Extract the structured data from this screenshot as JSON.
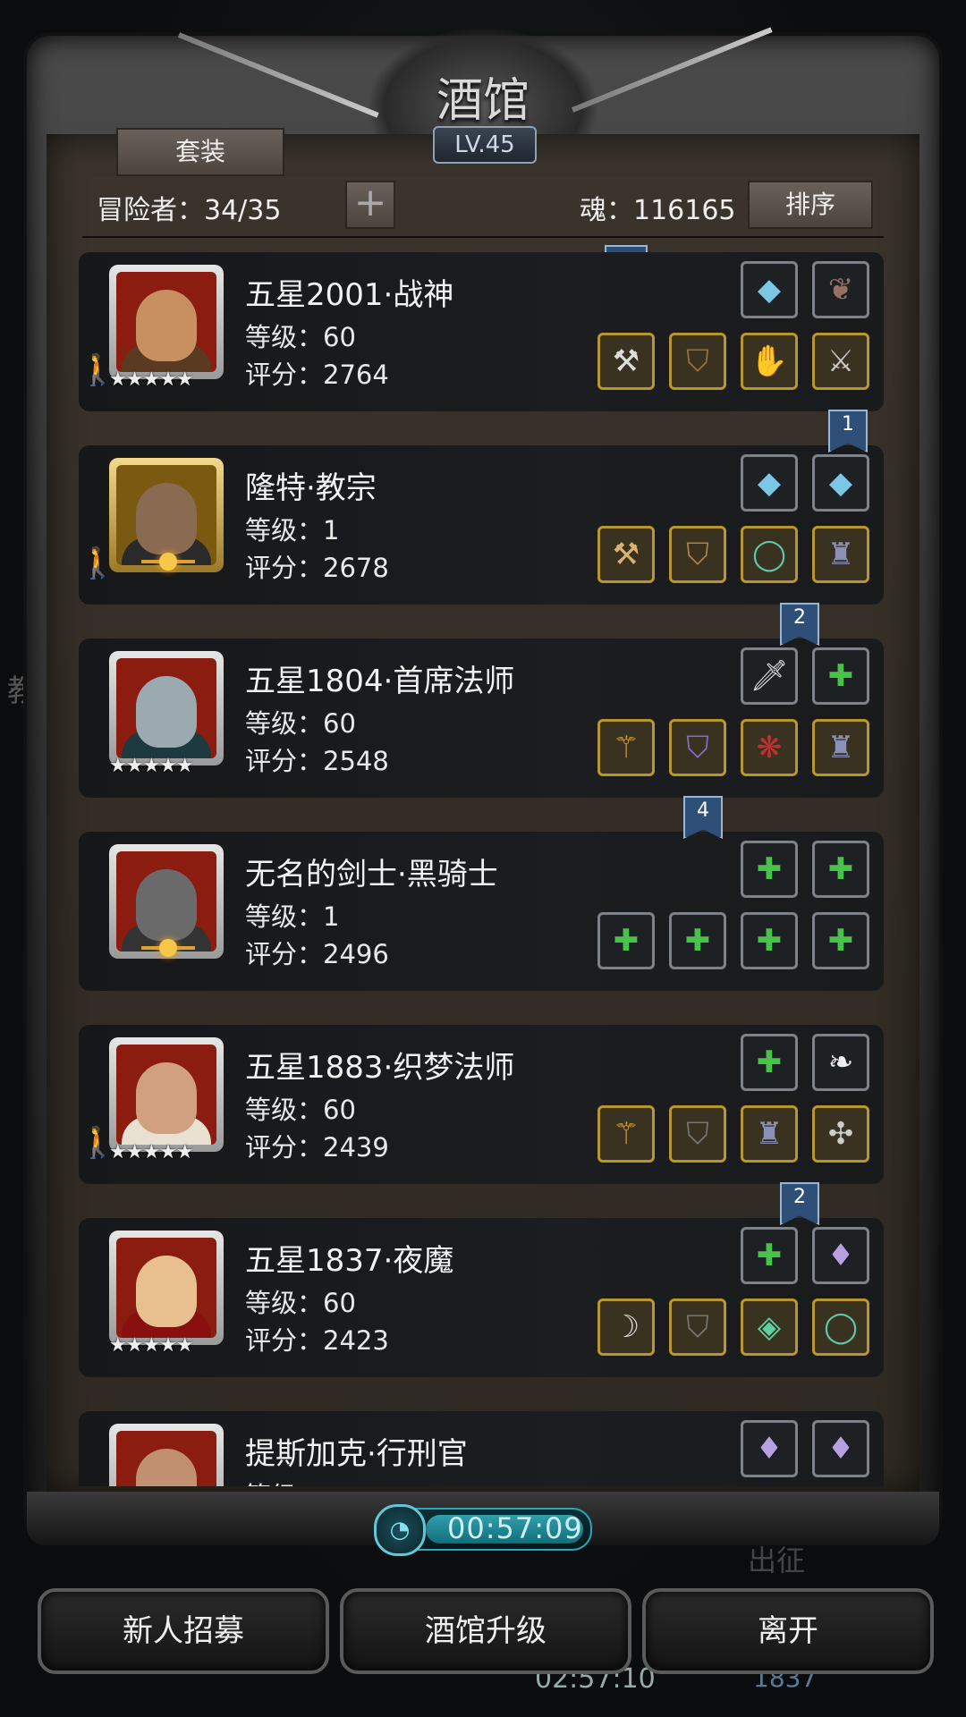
{
  "title": "酒馆",
  "level_badge": "LV.45",
  "suit_button": "套装",
  "adventurers": "冒险者：34/35",
  "plus_button": "+",
  "soul": "魂：116165",
  "sort_button": "排序",
  "background": {
    "side_text": "教",
    "bottom_timer": "02:57:10",
    "bottom_num": "1837",
    "chuzheng": "出征"
  },
  "heroes": [
    {
      "name": "五星2001·战神",
      "level": "等级：60",
      "score": "评分：2764",
      "frame": "red",
      "stars": "★★★★★",
      "badge": "star-walker",
      "top_slots": [
        {
          "icon": "blue-gem-icon",
          "border": "grey"
        },
        {
          "icon": "dark-feather-icon",
          "border": "grey"
        }
      ],
      "bottom_slots": [
        {
          "icon": "axe-icon",
          "border": "gold"
        },
        {
          "icon": "leather-armor-icon",
          "border": "gold"
        },
        {
          "icon": "gauntlet-icon",
          "border": "gold"
        },
        {
          "icon": "claw-icon",
          "border": "gold"
        }
      ]
    },
    {
      "name": "隆特·教宗",
      "level": "等级：1",
      "score": "评分：2678",
      "frame": "gold",
      "stars": "",
      "badge": "moon-walker",
      "flag": "1",
      "top_slots": [
        {
          "icon": "blue-gem-icon",
          "border": "grey"
        },
        {
          "icon": "blue-gem-icon",
          "border": "grey"
        }
      ],
      "bottom_slots": [
        {
          "icon": "hammer-icon",
          "border": "gold"
        },
        {
          "icon": "chest-armor-icon",
          "border": "gold"
        },
        {
          "icon": "ring-icon",
          "border": "gold"
        },
        {
          "icon": "boots-icon",
          "border": "gold"
        }
      ]
    },
    {
      "name": "五星1804·首席法师",
      "level": "等级：60",
      "score": "评分：2548",
      "frame": "red",
      "stars": "★★★★★",
      "badge": "stars",
      "flag": "2",
      "top_slots": [
        {
          "icon": "dagger-icon",
          "border": "grey"
        },
        {
          "icon": "empty-slot-icon",
          "border": "grey"
        }
      ],
      "bottom_slots": [
        {
          "icon": "staff-icon",
          "border": "gold"
        },
        {
          "icon": "purple-armor-icon",
          "border": "gold"
        },
        {
          "icon": "amulet-icon",
          "border": "gold"
        },
        {
          "icon": "boots-icon",
          "border": "gold"
        }
      ]
    },
    {
      "name": "无名的剑士·黑骑士",
      "level": "等级：1",
      "score": "评分：2496",
      "frame": "red",
      "stars": "",
      "badge": "moon",
      "flag": "4",
      "top_slots": [
        {
          "icon": "empty-slot-icon",
          "border": "grey"
        },
        {
          "icon": "empty-slot-icon",
          "border": "grey"
        }
      ],
      "bottom_slots": [
        {
          "icon": "empty-weapon-icon",
          "border": "grey"
        },
        {
          "icon": "empty-armor-icon",
          "border": "grey"
        },
        {
          "icon": "empty-ring-icon",
          "border": "grey"
        },
        {
          "icon": "empty-ring-icon",
          "border": "grey"
        }
      ]
    },
    {
      "name": "五星1883·织梦法师",
      "level": "等级：60",
      "score": "评分：2439",
      "frame": "red",
      "stars": "★★★★★",
      "badge": "star-walker",
      "top_slots": [
        {
          "icon": "empty-slot-icon",
          "border": "grey"
        },
        {
          "icon": "white-feather-icon",
          "border": "grey"
        }
      ],
      "bottom_slots": [
        {
          "icon": "staff-icon",
          "border": "gold"
        },
        {
          "icon": "dark-armor-icon",
          "border": "gold"
        },
        {
          "icon": "boots-icon",
          "border": "gold"
        },
        {
          "icon": "chain-amulet-icon",
          "border": "gold"
        }
      ]
    },
    {
      "name": "五星1837·夜魔",
      "level": "等级：60",
      "score": "评分：2423",
      "frame": "red",
      "stars": "★★★★★",
      "badge": "stars",
      "flag": "2",
      "top_slots": [
        {
          "icon": "empty-slot-icon",
          "border": "grey"
        },
        {
          "icon": "purple-crystal-icon",
          "border": "grey"
        }
      ],
      "bottom_slots": [
        {
          "icon": "curved-blade-icon",
          "border": "gold"
        },
        {
          "icon": "dark-armor-icon",
          "border": "gold"
        },
        {
          "icon": "green-gem-icon",
          "border": "gold"
        },
        {
          "icon": "ring-icon",
          "border": "gold"
        }
      ]
    },
    {
      "name": "提斯加克·行刑官",
      "level": "等级：",
      "score": "",
      "frame": "red",
      "stars": "",
      "badge": "none",
      "top_slots": [
        {
          "icon": "purple-crystal-icon",
          "border": "grey"
        },
        {
          "icon": "purple-crystal-icon",
          "border": "grey"
        }
      ],
      "bottom_slots": []
    }
  ],
  "timer": "00:57:09",
  "buttons": {
    "recruit": "新人招募",
    "upgrade": "酒馆升级",
    "leave": "离开"
  },
  "colors": {
    "gold_border": "#b8962e",
    "grey_border": "#7d8388",
    "red_frame": "#8b1d10",
    "timer_accent": "#2aa7b8"
  }
}
